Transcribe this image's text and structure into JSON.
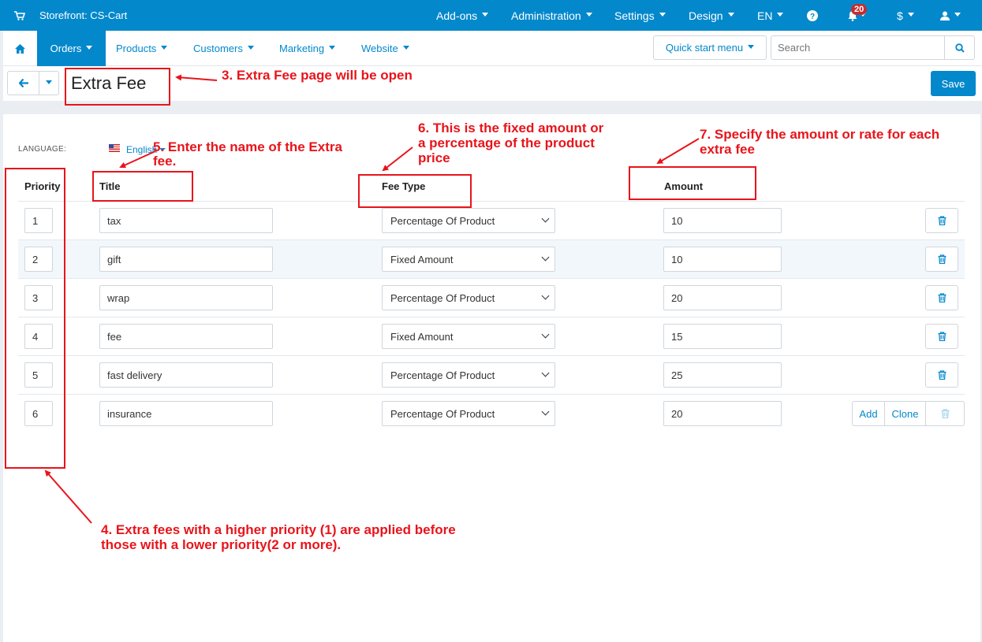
{
  "topbar": {
    "store": "Storefront: CS-Cart",
    "menu": [
      "Add-ons",
      "Administration",
      "Settings",
      "Design",
      "EN"
    ],
    "notifications_count": "20",
    "currency": "$"
  },
  "nav": {
    "active": "Orders",
    "items": [
      "Products",
      "Customers",
      "Marketing",
      "Website"
    ],
    "quick_start": "Quick start menu",
    "search_placeholder": "Search"
  },
  "toolbar": {
    "title": "Extra Fee",
    "save": "Save"
  },
  "language": {
    "label": "LANGUAGE:",
    "value": "English"
  },
  "table": {
    "headers": {
      "priority": "Priority",
      "title": "Title",
      "fee_type": "Fee Type",
      "amount": "Amount"
    },
    "rows": [
      {
        "priority": "1",
        "title": "tax",
        "fee_type": "Percentage Of Product",
        "amount": "10"
      },
      {
        "priority": "2",
        "title": "gift",
        "fee_type": "Fixed Amount",
        "amount": "10"
      },
      {
        "priority": "3",
        "title": "wrap",
        "fee_type": "Percentage Of Product",
        "amount": "20"
      },
      {
        "priority": "4",
        "title": "fee",
        "fee_type": "Fixed Amount",
        "amount": "15"
      },
      {
        "priority": "5",
        "title": "fast delivery",
        "fee_type": "Percentage Of Product",
        "amount": "25"
      },
      {
        "priority": "6",
        "title": "insurance",
        "fee_type": "Percentage Of Product",
        "amount": "20"
      }
    ],
    "add": "Add",
    "clone": "Clone"
  },
  "annotations": {
    "a3": "3. Extra Fee page will be open",
    "a5_1": "5. Enter the name of the Extra",
    "a5_2": "fee.",
    "a6_1": "6. This is the fixed amount or",
    "a6_2": "a percentage of the product",
    "a6_3": "price",
    "a7_1": "7. Specify the amount or rate for each",
    "a7_2": "extra fee",
    "a4_1": "4. Extra fees with a higher priority (1) are applied before",
    "a4_2": "those with a lower priority(2 or more)."
  },
  "colors": {
    "brand": "#0388cc",
    "annotation": "#e8141b",
    "badge": "#c52d2f"
  }
}
